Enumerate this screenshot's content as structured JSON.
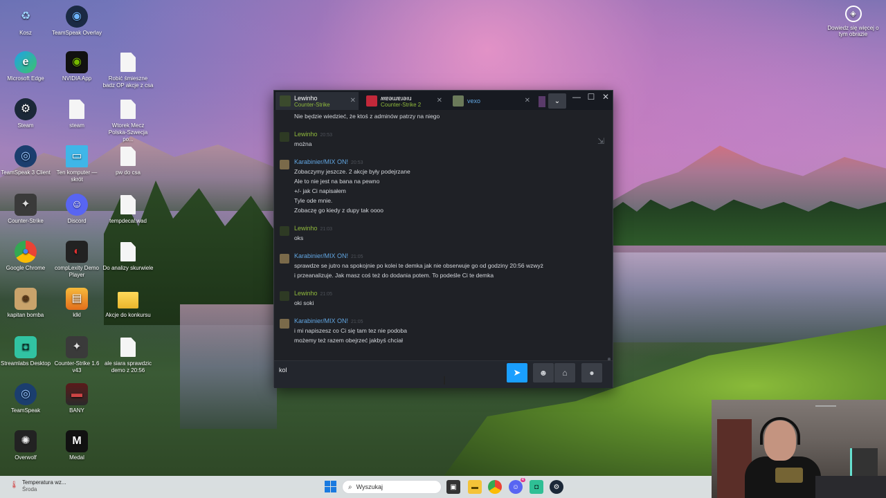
{
  "desktop_icons": [
    {
      "label": "Kosz",
      "icon": "recycle-bin-icon"
    },
    {
      "label": "TeamSpeak Overlay",
      "icon": "teamspeak-overlay-icon"
    },
    {
      "label": "Microsoft Edge",
      "icon": "edge-icon"
    },
    {
      "label": "NVIDIA App",
      "icon": "nvidia-icon"
    },
    {
      "label": "Robić śmieszne badz OP akcje z csa",
      "icon": "text-file-icon"
    },
    {
      "label": "Steam",
      "icon": "steam-icon"
    },
    {
      "label": "steam",
      "icon": "file-icon"
    },
    {
      "label": "Wtorek Mecz Polska-Szwecja po...",
      "icon": "text-file-icon"
    },
    {
      "label": "TeamSpeak 3 Client",
      "icon": "teamspeak-icon"
    },
    {
      "label": "Ten komputer — skrót",
      "icon": "computer-icon"
    },
    {
      "label": "pw do csa",
      "icon": "text-file-icon"
    },
    {
      "label": "Counter-Strike",
      "icon": "counter-strike-icon"
    },
    {
      "label": "Discord",
      "icon": "discord-icon"
    },
    {
      "label": "tempdecal.wad",
      "icon": "file-icon"
    },
    {
      "label": "Google Chrome",
      "icon": "chrome-icon"
    },
    {
      "label": "compLexity Demo Player",
      "icon": "demo-player-icon"
    },
    {
      "label": "Do analizy skurwiele",
      "icon": "text-file-icon"
    },
    {
      "label": "kapitan bomba",
      "icon": "kapitan-bomba-icon"
    },
    {
      "label": "klkl",
      "icon": "folder-image-icon"
    },
    {
      "label": "Akcje do konkursu",
      "icon": "folder-icon"
    },
    {
      "label": "Streamlabs Desktop",
      "icon": "streamlabs-icon"
    },
    {
      "label": "Counter-Strike 1.6 v43",
      "icon": "counter-strike-icon"
    },
    {
      "label": "ale siara sprawdzic demo z 20:56",
      "icon": "text-file-icon"
    },
    {
      "label": "TeamSpeak",
      "icon": "teamspeak-icon"
    },
    {
      "label": "BANY",
      "icon": "image-file-icon"
    },
    {
      "label": "Overwolf",
      "icon": "overwolf-icon"
    },
    {
      "label": "Medal",
      "icon": "medal-icon"
    }
  ],
  "learn_more": {
    "label": "Dowiedz się więcej o tym obrazie"
  },
  "chat": {
    "tabs": [
      {
        "name": "Lewinho",
        "status": "Counter-Strike",
        "name_color": "#ffffff"
      },
      {
        "name": "ʍɐǝɯɐɹǝıu",
        "status": "Counter-Strike 2",
        "name_color": "#ffffff"
      },
      {
        "name": "vexo",
        "status": "",
        "name_color": "#62a7e3"
      }
    ],
    "tab_close": "✕",
    "controls": {
      "minimize": "—",
      "maximize": "☐",
      "close": "✕",
      "dropdown": "⌄"
    },
    "messages": [
      {
        "author": "",
        "time": "",
        "lines": [
          "Nie będzie wiedzieć, że ktoś z adminów patrzy na niego"
        ]
      },
      {
        "author": "Lewinho",
        "time": "20:53",
        "lines": [
          "można"
        ]
      },
      {
        "author": "Karabinier/MIX ON!",
        "time": "20:53",
        "lines": [
          "Zobaczymy jeszcze. 2 akcje były podejrzane",
          "Ale to nie jest na bana na pewno",
          "+/- jak Ci napisałem",
          "Tyle ode mnie.",
          "Zobaczę go kiedy z dupy tak oooo"
        ]
      },
      {
        "author": "Lewinho",
        "time": "21:03",
        "lines": [
          "oks"
        ]
      },
      {
        "author": "Karabinier/MIX ON!",
        "time": "21:05",
        "lines": [
          "sprawdze se jutro na spokojnie po kolei te demka jak nie obserwuje go od godziny 20:56 wzwyż",
          "i przeanalizuje. Jak masz coś też do dodania potem. To podeśle Ci te demka"
        ]
      },
      {
        "author": "Lewinho",
        "time": "21:05",
        "lines": [
          "oki soki"
        ]
      },
      {
        "author": "Karabinier/MIX ON!",
        "time": "21:05",
        "lines": [
          "i mi napiszesz co Ci się tam tez nie podoba",
          "możemy też razem obejrzeć jakbyś chciał"
        ]
      }
    ],
    "input_value": "kol",
    "buttons": {
      "send": "➤",
      "emoji": "☻",
      "attach": "⌂",
      "voice": "●"
    }
  },
  "taskbar": {
    "weather_title": "Temperatura wz...",
    "weather_sub": "Środa",
    "search_placeholder": "Wyszukaj",
    "discord_badge": "4"
  },
  "colors": {
    "accent_blue": "#1a9fff",
    "author_green": "#90ba3c",
    "author_blue": "#62a7e3",
    "chat_bg": "#1f2126"
  }
}
